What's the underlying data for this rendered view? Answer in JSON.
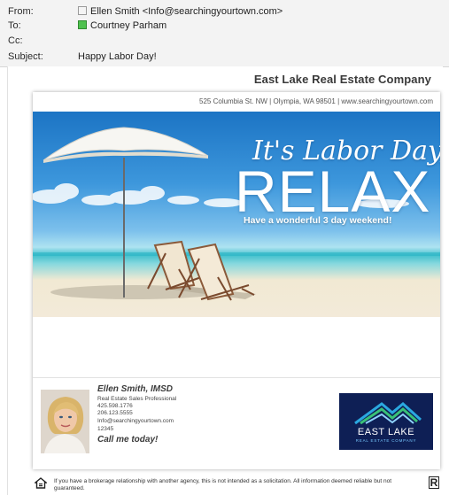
{
  "header": {
    "from_label": "From:",
    "from_value": "Ellen Smith <Info@searchingyourtown.com>",
    "to_label": "To:",
    "to_value": "Courtney Parham",
    "cc_label": "Cc:",
    "cc_value": "",
    "subject_label": "Subject:",
    "subject_value": "Happy Labor Day!"
  },
  "email": {
    "company_heading": "East Lake Real Estate Company",
    "address_line": "525 Columbia St. NW | Olympia, WA 98501 | www.searchingyourtown.com",
    "hero": {
      "tagline": "It's Labor Day,",
      "headline": "RELAX",
      "subtitle": "Have a wonderful 3 day weekend!"
    },
    "agent": {
      "name": "Ellen Smith, IMSD",
      "title": "Real Estate Sales Professional",
      "phone1": "425.598.1776",
      "phone2": "206.123.5555",
      "email": "Info@searchingyourtown.com",
      "license": "12345",
      "cta": "Call me today!"
    },
    "logo": {
      "name": "EAST LAKE",
      "tagline": "REAL ESTATE COMPANY"
    },
    "disclaimer": "If you have a brokerage relationship with another agency, this is not intended as a solicitation. All information deemed reliable but not guaranteed."
  },
  "icons": {
    "from_presence": "presence-icon",
    "to_presence": "presence-online-icon",
    "equal_housing": "equal-housing-icon",
    "realtor": "realtor-icon",
    "realtor_glyph": "R"
  },
  "colors": {
    "brand_navy": "#0e1f55",
    "logo_accent": "#78c8ff",
    "presence_green": "#4ec14e"
  }
}
